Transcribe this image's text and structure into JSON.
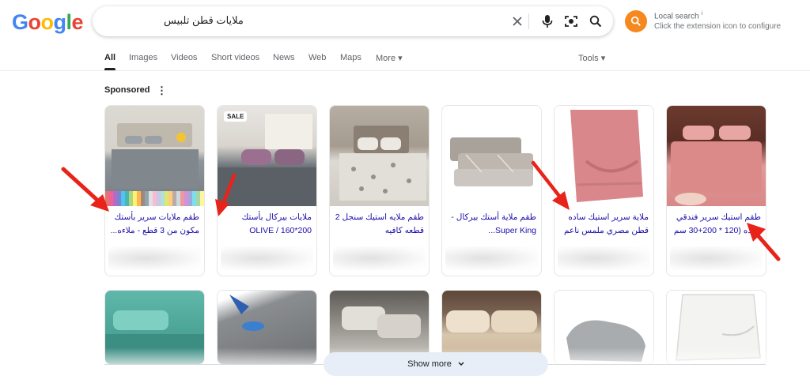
{
  "logo": {
    "letters": [
      "G",
      "o",
      "o",
      "g",
      "l",
      "e"
    ],
    "colors": [
      "#4285f4",
      "#ea4335",
      "#fbbc05",
      "#4285f4",
      "#34a853",
      "#ea4335"
    ]
  },
  "search": {
    "query": "ملايات قطن تلبيس"
  },
  "local_search": {
    "title": "Local search",
    "superscript": "i",
    "subtitle": "Click the extension icon to configure",
    "accent": "#f5891f"
  },
  "tabs": [
    {
      "label": "All",
      "active": true
    },
    {
      "label": "Images"
    },
    {
      "label": "Videos"
    },
    {
      "label": "Short videos"
    },
    {
      "label": "News"
    },
    {
      "label": "Web"
    },
    {
      "label": "Maps"
    },
    {
      "label": "More ▾"
    }
  ],
  "tools_label": "Tools ▾",
  "sponsored_label": "Sponsored",
  "kebab": "⋮",
  "products": [
    {
      "title": "طقم ملايات سرير بأستك مكون من 3 قطع - ملاءه...",
      "sale": ""
    },
    {
      "title": "ملايات بيركال بأستك OLIVE / 160*200",
      "sale": "SALE"
    },
    {
      "title": "طقم ملايه استيك سنجل 2 قطعه كافيه",
      "sale": ""
    },
    {
      "title": "طقم ملاية أستك بيركال - Super King...",
      "sale": ""
    },
    {
      "title": "ملاية سرير استيك ساده قطن مصري ملمس ناعم",
      "sale": ""
    },
    {
      "title": "طقم استيك سرير فندقي ساده (120 * 200+30 سم",
      "sale": ""
    }
  ],
  "show_more_label": "Show more",
  "arrow_color": "#e8231a"
}
